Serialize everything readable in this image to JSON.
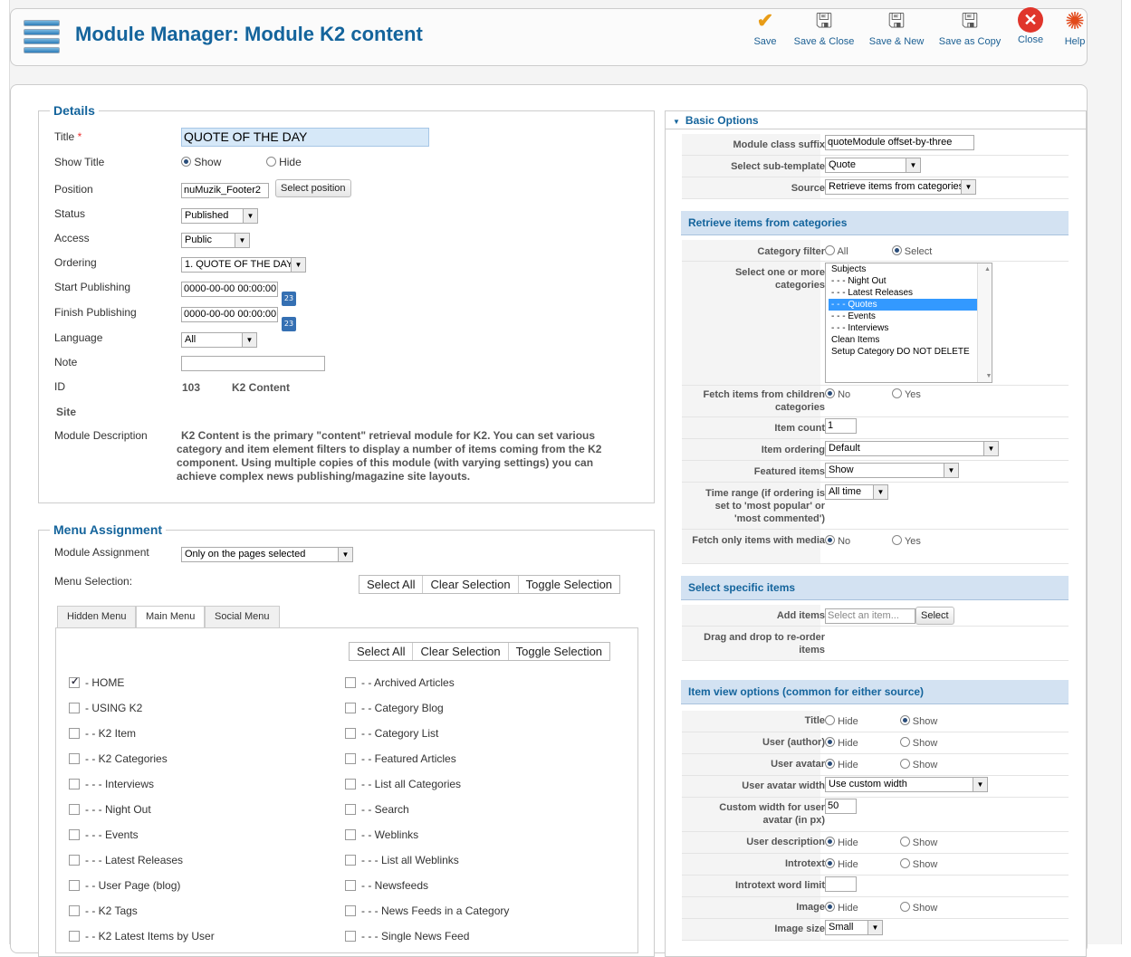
{
  "toolbar": {
    "title": "Module Manager: Module K2 content",
    "buttons": [
      {
        "label": "Save",
        "icon": "checkmark-icon"
      },
      {
        "label": "Save & Close",
        "icon": "disk-icon"
      },
      {
        "label": "Save & New",
        "icon": "disk-plus-icon"
      },
      {
        "label": "Save as Copy",
        "icon": "disk-copy-icon"
      },
      {
        "label": "Close",
        "icon": "close-icon"
      },
      {
        "label": "Help",
        "icon": "lifebuoy-icon"
      }
    ]
  },
  "details": {
    "legend": "Details",
    "title_label": "Title",
    "required_mark": "*",
    "title_value": "QUOTE OF THE DAY",
    "show_title_label": "Show Title",
    "show_opt": "Show",
    "hide_opt": "Hide",
    "position_label": "Position",
    "position_value": "nuMuzik_Footer2",
    "select_position": "Select position",
    "status_label": "Status",
    "status_value": "Published",
    "access_label": "Access",
    "access_value": "Public",
    "ordering_label": "Ordering",
    "ordering_value": "1. QUOTE OF THE DAY",
    "start_label": "Start Publishing",
    "start_value": "0000-00-00 00:00:00",
    "finish_label": "Finish Publishing",
    "finish_value": "0000-00-00 00:00:00",
    "cal_text": "23",
    "language_label": "Language",
    "language_value": "All",
    "note_label": "Note",
    "note_value": "",
    "id_label": "ID",
    "id_value": "103",
    "id_type": "K2 Content",
    "site_label": "Site",
    "desc_label": "Module Description",
    "desc_value": "K2 Content is the primary \"content\" retrieval module for K2. You can set various category and item element filters to display a number of items coming from the K2 component. Using multiple copies of this module (with varying settings) you can achieve complex news publishing/magazine site layouts."
  },
  "menu": {
    "legend": "Menu Assignment",
    "assign_label": "Module Assignment",
    "assign_value": "Only on the pages selected",
    "selection_label": "Menu Selection:",
    "select_all": "Select All",
    "clear_selection": "Clear Selection",
    "toggle_selection": "Toggle Selection",
    "tabs": [
      "Hidden Menu",
      "Main Menu",
      "Social Menu"
    ],
    "left_items": [
      {
        "label": "- HOME",
        "checked": true
      },
      {
        "label": "- USING K2",
        "checked": false
      },
      {
        "label": "- - K2 Item",
        "checked": false
      },
      {
        "label": "- - K2 Categories",
        "checked": false
      },
      {
        "label": "- - - Interviews",
        "checked": false
      },
      {
        "label": "- - - Night Out",
        "checked": false
      },
      {
        "label": "- - - Events",
        "checked": false
      },
      {
        "label": "- - - Latest Releases",
        "checked": false
      },
      {
        "label": "- - User Page (blog)",
        "checked": false
      },
      {
        "label": "- - K2 Tags",
        "checked": false
      },
      {
        "label": "- - K2 Latest Items by User",
        "checked": false
      }
    ],
    "right_items": [
      {
        "label": "- - Archived Articles",
        "checked": false
      },
      {
        "label": "- - Category Blog",
        "checked": false
      },
      {
        "label": "- - Category List",
        "checked": false
      },
      {
        "label": "- - Featured Articles",
        "checked": false
      },
      {
        "label": "- - List all Categories",
        "checked": false
      },
      {
        "label": "- - Search",
        "checked": false
      },
      {
        "label": "- - Weblinks",
        "checked": false
      },
      {
        "label": "- - - List all Weblinks",
        "checked": false
      },
      {
        "label": "- - Newsfeeds",
        "checked": false
      },
      {
        "label": "- - - News Feeds in a Category",
        "checked": false
      },
      {
        "label": "- - - Single News Feed",
        "checked": false
      }
    ]
  },
  "basic": {
    "header": "Basic Options",
    "class_suffix_label": "Module class suffix",
    "class_suffix_value": "quoteModule offset-by-three",
    "subtemplate_label": "Select sub-template",
    "subtemplate_value": "Quote",
    "source_label": "Source",
    "source_value": "Retrieve items from categories",
    "sec_retrieve": "Retrieve items from categories",
    "cat_filter_label": "Category filter",
    "all_opt": "All",
    "select_opt": "Select",
    "select_cats_label": "Select one or more categories",
    "categories": [
      "Subjects",
      "- - - Night Out",
      "- - - Latest Releases",
      "- - - Quotes",
      "- - - Events",
      "- - - Interviews",
      "Clean Items",
      "Setup Category DO NOT DELETE"
    ],
    "fetch_children_label": "Fetch items from children categories",
    "no_opt": "No",
    "yes_opt": "Yes",
    "item_count_label": "Item count",
    "item_count_value": "1",
    "item_ordering_label": "Item ordering",
    "item_ordering_value": "Default",
    "featured_label": "Featured items",
    "featured_value": "Show",
    "time_range_label": "Time range (if ordering is set to 'most popular' or 'most commented')",
    "time_range_value": "All time",
    "fetch_media_label": "Fetch only items with media",
    "sec_specific": "Select specific items",
    "add_items_label": "Add items",
    "add_items_placeholder": "Select an item...",
    "select_btn": "Select",
    "drag_label": "Drag and drop to re-order items",
    "sec_view": "Item view options (common for either source)",
    "title_label": "Title",
    "hide_opt": "Hide",
    "show_opt": "Show",
    "user_author_label": "User (author)",
    "user_avatar_label": "User avatar",
    "avatar_width_label": "User avatar width",
    "avatar_width_value": "Use custom width",
    "custom_width_label": "Custom width for user avatar (in px)",
    "custom_width_value": "50",
    "user_desc_label": "User description",
    "introtext_label": "Introtext",
    "intro_limit_label": "Introtext word limit",
    "intro_limit_value": "",
    "image_label": "Image",
    "image_size_label": "Image size",
    "image_size_value": "Small"
  }
}
